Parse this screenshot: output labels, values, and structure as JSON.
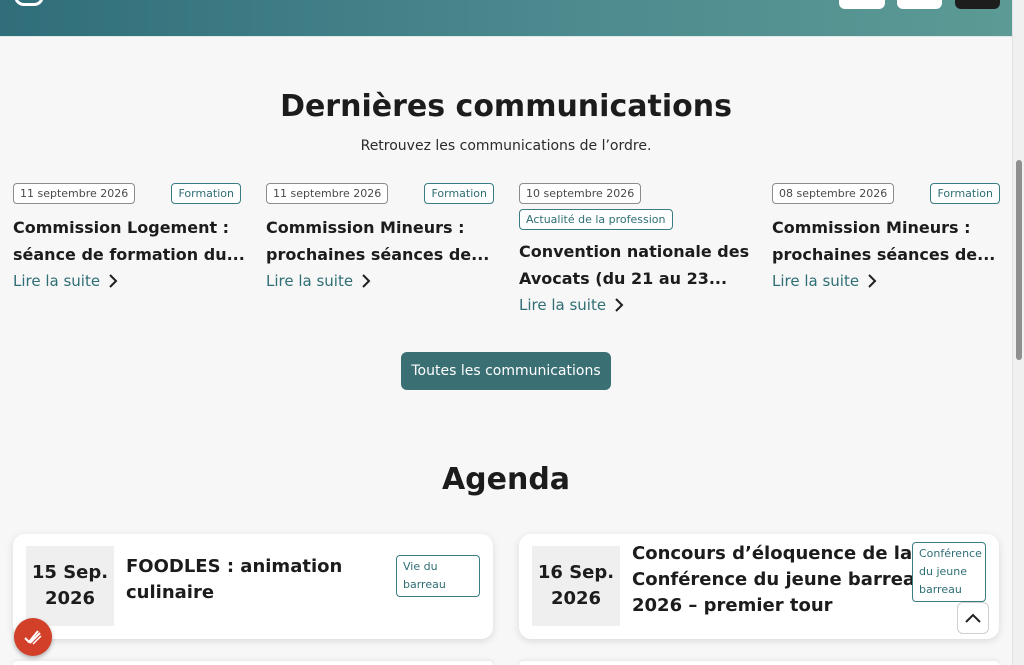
{
  "communications": {
    "title": "Dernières communications",
    "subtitle": "Retrouvez les communications de l’ordre.",
    "read_more": "Lire la suite",
    "all_button": "Toutes les communications",
    "items": [
      {
        "date": "11 septembre 2026",
        "category": "Formation",
        "title_line1": "Commission Logement :",
        "title_line2": "séance de formation du..."
      },
      {
        "date": "11 septembre 2026",
        "category": "Formation",
        "title_line1": "Commission Mineurs :",
        "title_line2": "prochaines séances de..."
      },
      {
        "date": "10 septembre 2026",
        "category": "Actualité de la profession",
        "title_line1": "Convention nationale des",
        "title_line2": "Avocats (du 21 au 23..."
      },
      {
        "date": "08 septembre 2026",
        "category": "Formation",
        "title_line1": "Commission Mineurs :",
        "title_line2": "prochaines séances de..."
      }
    ]
  },
  "agenda": {
    "title": "Agenda",
    "events": [
      {
        "day": "15 Sep.",
        "year": "2026",
        "title_line1": "FOODLES : animation",
        "title_line2": "culinaire",
        "title_line3": "",
        "tag_line1": "Vie du",
        "tag_line2": "barreau",
        "tag_line3": ""
      },
      {
        "day": "16 Sep.",
        "year": "2026",
        "title_line1": "Concours d’éloquence de la",
        "title_line2": "Conférence du jeune barreau",
        "title_line3": "2026 – premier tour",
        "tag_line1": "Conférence",
        "tag_line2": "du jeune",
        "tag_line3": "barreau"
      }
    ]
  },
  "icons": {
    "read_more": "chevron-right-icon",
    "scroll_top": "chevron-up-icon",
    "fab": "checkmarks-icon"
  },
  "colors": {
    "accent": "#3a6f74",
    "header_start": "#2f6e7a",
    "header_end": "#5c9a95",
    "fab": "#d2402a"
  }
}
